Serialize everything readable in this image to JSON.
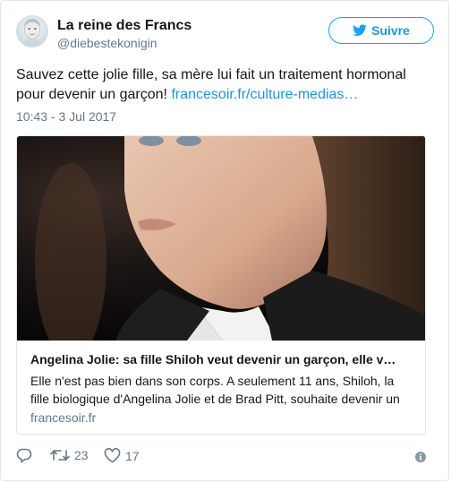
{
  "user": {
    "display_name": "La reine des Francs",
    "handle": "@diebestekonigin"
  },
  "follow_button": {
    "label": "Suivre",
    "icon": "twitter-bird-icon"
  },
  "tweet": {
    "text": "Sauvez cette jolie fille, sa mère lui fait un traitement hormonal pour devenir un garçon! ",
    "link": "francesoir.fr/culture-medias…",
    "timestamp": "10:43 - 3 Jul 2017"
  },
  "card": {
    "title": "Angelina Jolie: sa fille Shiloh veut devenir un garçon, elle v…",
    "description": "Elle n'est pas bien dans son corps. A seulement 11 ans, Shiloh, la fille biologique d'Angelina Jolie et de Brad Pitt, souhaite devenir un",
    "domain": "francesoir.fr"
  },
  "actions": {
    "reply": {
      "icon": "reply-icon"
    },
    "retweet": {
      "icon": "retweet-icon",
      "count": "23"
    },
    "like": {
      "icon": "heart-icon",
      "count": "17"
    },
    "info": {
      "icon": "info-icon"
    }
  },
  "colors": {
    "link_blue": "#1b95e0",
    "follow_border": "#1da1f2",
    "muted_gray": "#657786",
    "text": "#14171a",
    "border": "#e1e8ed"
  }
}
